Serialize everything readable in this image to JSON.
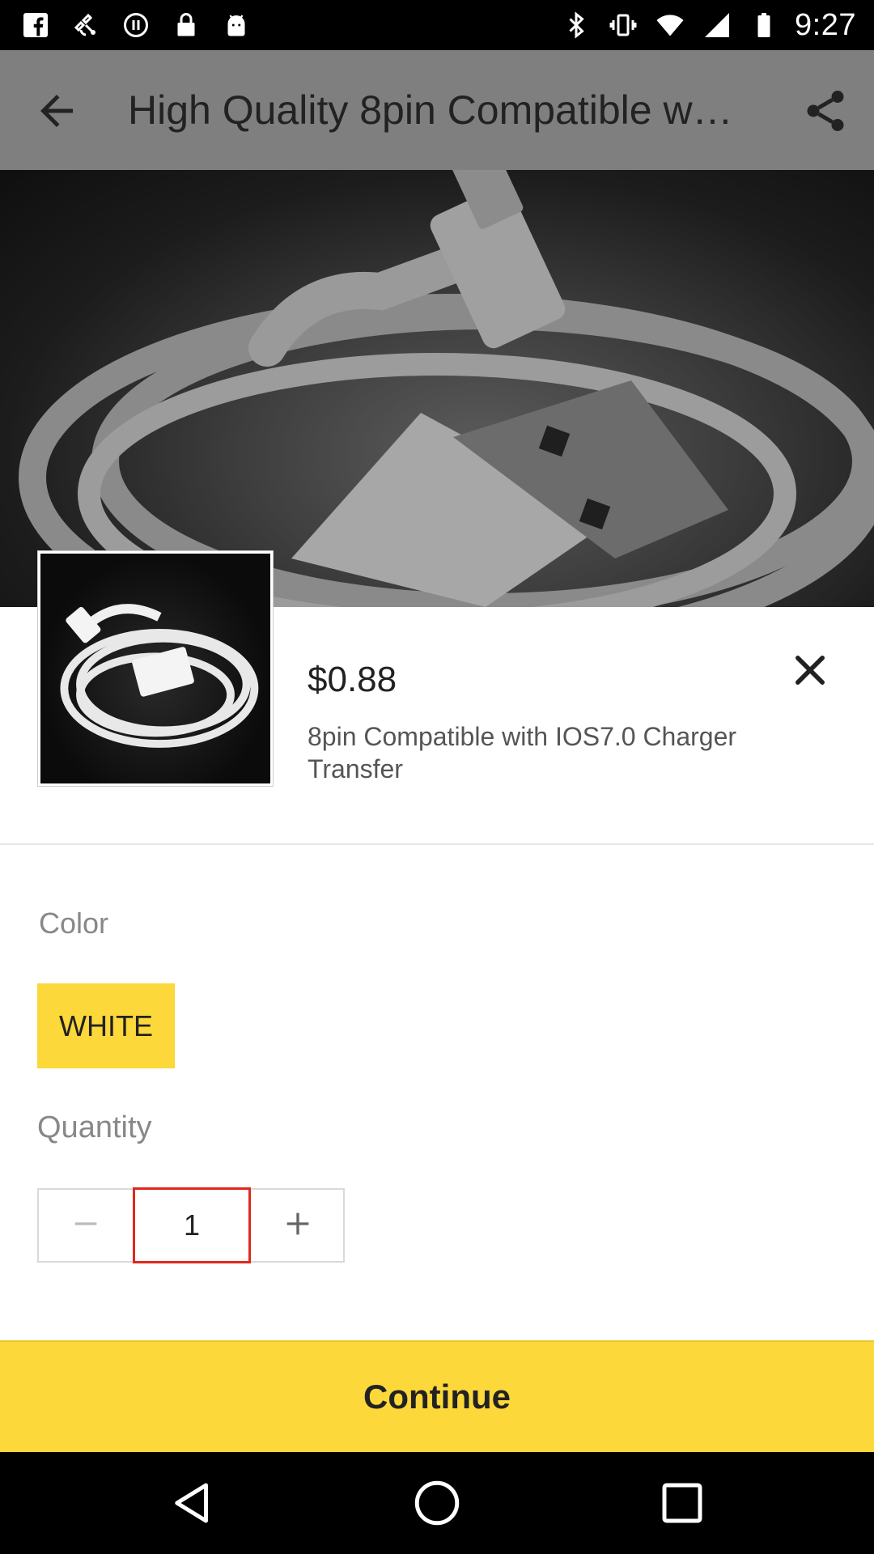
{
  "status_bar": {
    "time": "9:27",
    "left_icons": [
      "facebook-icon",
      "fake-gps-icon",
      "sync-icon",
      "lock-icon",
      "android-icon"
    ],
    "right_icons": [
      "bluetooth-icon",
      "vibrate-icon",
      "wifi-icon",
      "signal-icon",
      "battery-icon"
    ]
  },
  "header": {
    "title": "High Quality  8pin Compatible w…",
    "back_icon": "arrow-back-icon",
    "share_icon": "share-icon"
  },
  "sheet": {
    "price": "$0.88",
    "product_name": "8pin Compatible with IOS7.0 Charger Transfer",
    "close_icon": "close-icon",
    "color_label": "Color",
    "color_options": [
      {
        "label": "WHITE",
        "selected": true
      }
    ],
    "quantity_label": "Quantity",
    "quantity_value": "1",
    "continue_label": "Continue",
    "accent_color": "#fcd83a",
    "highlight_color": "#e0281e"
  },
  "nav_bar": {
    "icons": [
      "back-triangle-icon",
      "home-circle-icon",
      "recents-square-icon"
    ]
  }
}
